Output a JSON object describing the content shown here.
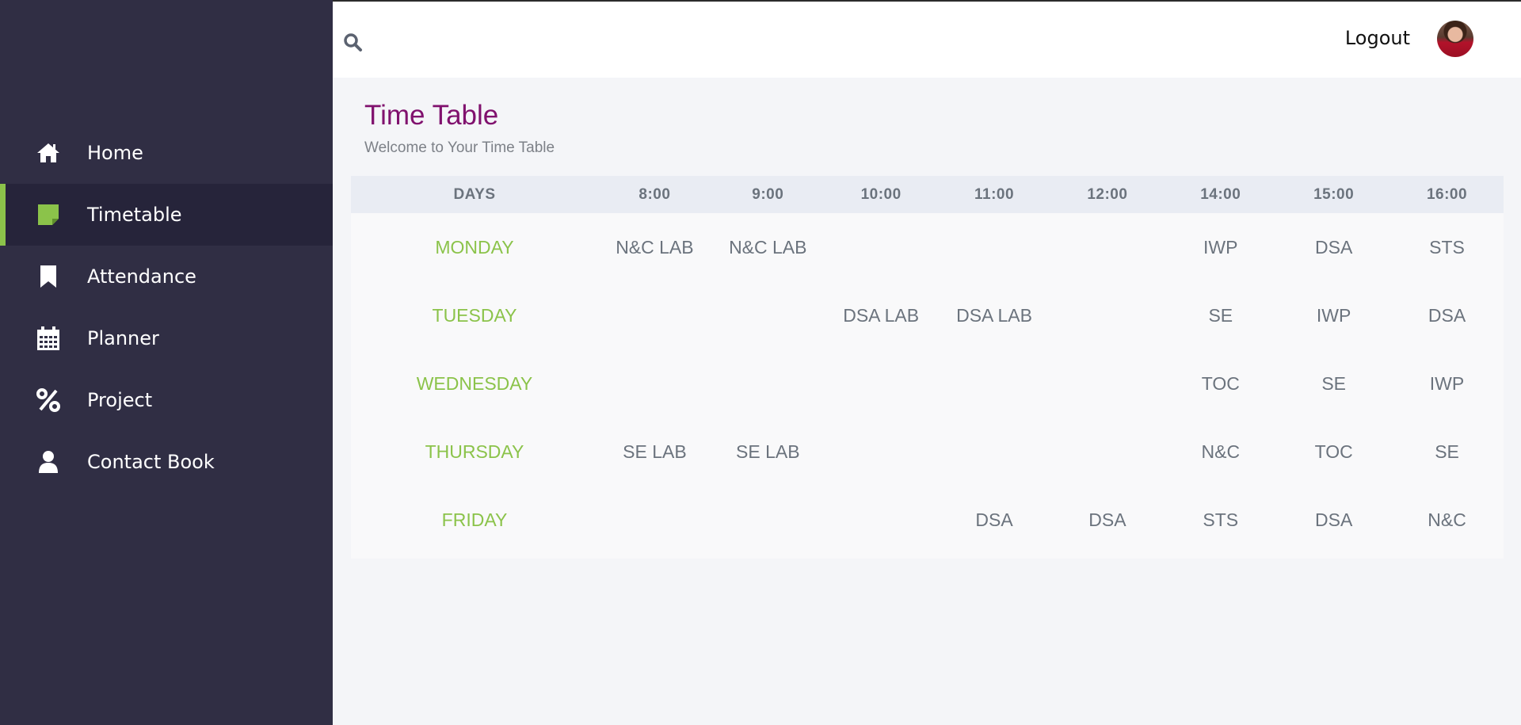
{
  "sidebar": {
    "items": [
      {
        "label": "Home",
        "icon": "home-icon",
        "active": false
      },
      {
        "label": "Timetable",
        "icon": "sticky-note-icon",
        "active": true
      },
      {
        "label": "Attendance",
        "icon": "bookmark-icon",
        "active": false
      },
      {
        "label": "Planner",
        "icon": "calendar-icon",
        "active": false
      },
      {
        "label": "Project",
        "icon": "percent-icon",
        "active": false
      },
      {
        "label": "Contact Book",
        "icon": "user-icon",
        "active": false
      }
    ],
    "accent_color": "#8bc34a",
    "background": "#302e44"
  },
  "header": {
    "logout_label": "Logout",
    "search_icon": "search-icon",
    "avatar_icon": "avatar"
  },
  "main": {
    "title": "Time Table",
    "subtitle": "Welcome to Your Time Table",
    "title_color": "#80116e"
  },
  "timetable": {
    "headers": [
      "DAYS",
      "8:00",
      "9:00",
      "10:00",
      "11:00",
      "12:00",
      "14:00",
      "15:00",
      "16:00"
    ],
    "rows": [
      {
        "day": "MONDAY",
        "slots": [
          "N&C LAB",
          "N&C LAB",
          "",
          "",
          "",
          "IWP",
          "DSA",
          "STS"
        ]
      },
      {
        "day": "TUESDAY",
        "slots": [
          "",
          "",
          "DSA LAB",
          "DSA LAB",
          "",
          "SE",
          "IWP",
          "DSA"
        ]
      },
      {
        "day": "WEDNESDAY",
        "slots": [
          "",
          "",
          "",
          "",
          "",
          "TOC",
          "SE",
          "IWP"
        ]
      },
      {
        "day": "THURSDAY",
        "slots": [
          "SE LAB",
          "SE LAB",
          "",
          "",
          "",
          "N&C",
          "TOC",
          "SE"
        ]
      },
      {
        "day": "FRIDAY",
        "slots": [
          "",
          "",
          "",
          "DSA",
          "DSA",
          "STS",
          "DSA",
          "N&C"
        ]
      }
    ]
  }
}
